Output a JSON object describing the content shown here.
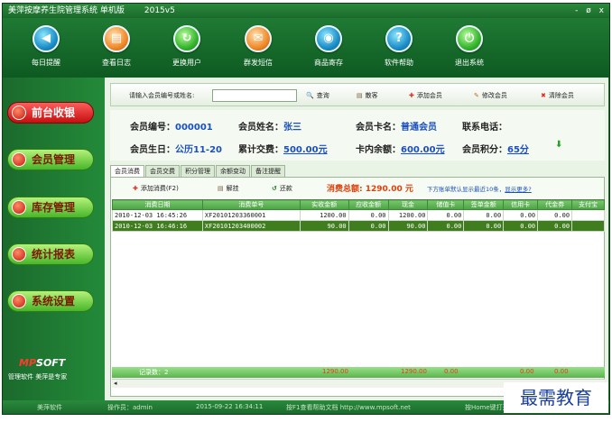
{
  "window": {
    "title": "美萍按摩养生院管理系统 单机版",
    "version": "2015v5",
    "controls": [
      "-",
      "ø",
      "x"
    ]
  },
  "toolbar": [
    {
      "label": "每日提醒",
      "icon": "reminder-icon",
      "glyph": "◀"
    },
    {
      "label": "查看日志",
      "icon": "log-icon",
      "glyph": "▤"
    },
    {
      "label": "更换用户",
      "icon": "switch-user-icon",
      "glyph": "↻"
    },
    {
      "label": "群发短信",
      "icon": "sms-icon",
      "glyph": "✉"
    },
    {
      "label": "商品寄存",
      "icon": "storage-icon",
      "glyph": "◉"
    },
    {
      "label": "软件帮助",
      "icon": "help-icon",
      "glyph": "?"
    },
    {
      "label": "退出系统",
      "icon": "power-icon",
      "glyph": "⏻"
    }
  ],
  "sidebar": [
    {
      "label": "前台收银",
      "active": true
    },
    {
      "label": "会员管理",
      "active": false
    },
    {
      "label": "库存管理",
      "active": false
    },
    {
      "label": "统计报表",
      "active": false
    },
    {
      "label": "系统设置",
      "active": false
    }
  ],
  "brand": {
    "logo_mp": "MP",
    "logo_soft": "SOFT",
    "slogan": "管理软件  美萍是专家"
  },
  "search": {
    "label": "请输入会员编号或姓名:",
    "value": ""
  },
  "actions": [
    {
      "label": "查询",
      "icon": "search-icon",
      "glyph": "🔍"
    },
    {
      "label": "散客",
      "icon": "guest-icon",
      "glyph": "▤"
    },
    {
      "label": "添加会员",
      "icon": "add-member-icon",
      "glyph": "✚"
    },
    {
      "label": "修改会员",
      "icon": "edit-member-icon",
      "glyph": "✎"
    },
    {
      "label": "清除会员",
      "icon": "clear-member-icon",
      "glyph": "✖"
    }
  ],
  "member": {
    "id_label": "会员编号：",
    "id": "000001",
    "name_label": "会员姓名：",
    "name": "张三",
    "card_label": "会员卡名：",
    "card": "普通会员",
    "phone_label": "联系电话：",
    "phone": "",
    "birthday_label": "会员生日：",
    "birthday": "公历11-20",
    "total_label": "累计交费：",
    "total": "500.00元",
    "balance_label": "卡内余额：",
    "balance": "600.00元",
    "points_label": "会员积分：",
    "points": "65分"
  },
  "tabs": [
    "会员消费",
    "会员交费",
    "积分管理",
    "余额变动",
    "备注提醒"
  ],
  "subactions": [
    {
      "label": "添加消费(F2)",
      "icon": "add-icon",
      "glyph": "✚"
    },
    {
      "label": "解挂",
      "icon": "release-icon",
      "glyph": "▤"
    },
    {
      "label": "还款",
      "icon": "repay-icon",
      "glyph": "↺"
    }
  ],
  "consumption_total": "消费总额: 1290.00 元",
  "hint": {
    "text": "下方账单默认显示最近10条，",
    "link": "显示更多?"
  },
  "table": {
    "columns": [
      "消费日期",
      "消费单号",
      "实收金额",
      "应收金额",
      "现金",
      "储值卡",
      "签单金额",
      "信用卡",
      "代金券",
      "支付宝"
    ],
    "rows": [
      [
        "2010-12-03 16:45:26",
        "XF20101203360001",
        "1200.00",
        "0.00",
        "1200.00",
        "0.00",
        "0.00",
        "0.00",
        "0.00",
        ""
      ],
      [
        "2010-12-03 16:46:16",
        "XF20101203400002",
        "90.00",
        "0.00",
        "90.00",
        "0.00",
        "0.00",
        "0.00",
        "0.00",
        ""
      ]
    ]
  },
  "footer": {
    "count": "记录数：2",
    "sum1": "1290.00",
    "sum2": "1290.00",
    "sum3": "0.00",
    "sum4": "0.00",
    "sum5": "0.00"
  },
  "statusbar": {
    "app": "美萍软件",
    "operator": "操作员：admin",
    "datetime": "2015-09-22 16:34:11",
    "help": "按F1查看帮助文档  http://www.mpsoft.net",
    "home": "按Home键打开……"
  },
  "watermark": "最需教育"
}
